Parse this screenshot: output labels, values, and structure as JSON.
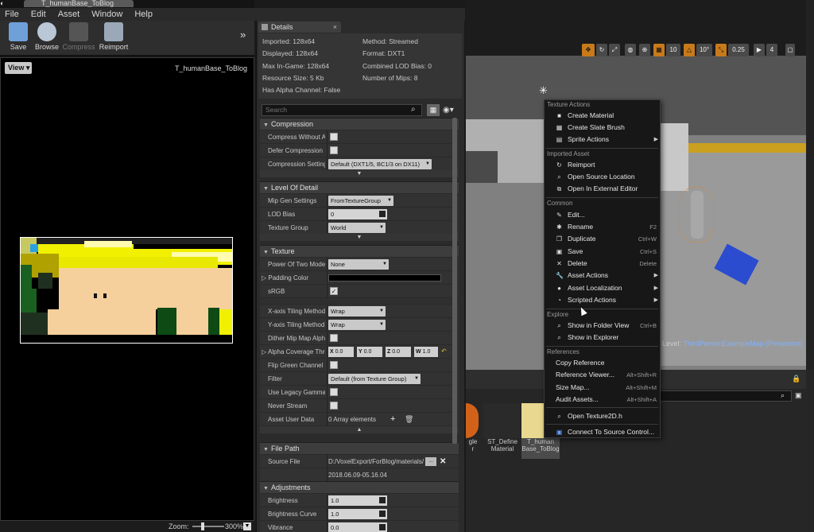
{
  "window": {
    "tab_title": "T_humanBase_ToBlog",
    "menu": [
      "File",
      "Edit",
      "Asset",
      "Window",
      "Help"
    ]
  },
  "toolbar": {
    "save": "Save",
    "browse": "Browse",
    "compress": "Compress",
    "reimport": "Reimport"
  },
  "viewport": {
    "view_button": "View",
    "asset_name": "T_humanBase_ToBlog",
    "zoom_label": "Zoom:",
    "zoom_value": "300%",
    "zoom_level": 0.3
  },
  "details": {
    "tab": "Details",
    "info_left": [
      "Imported: 128x64",
      "Displayed: 128x64",
      "Max In-Game: 128x64",
      "Resource Size: 5 Kb",
      "Has Alpha Channel: False"
    ],
    "info_right": [
      "Method: Streamed",
      "Format: DXT1",
      "Combined LOD Bias: 0",
      "Number of Mips: 8"
    ],
    "search_placeholder": "Search",
    "compression": {
      "header": "Compression",
      "compress_without_alpha": "Compress Without Al",
      "defer_compression": "Defer Compression",
      "compression_settings": "Compression Setting",
      "compression_settings_value": "Default (DXT1/5, BC1/3 on DX11)"
    },
    "lod": {
      "header": "Level Of Detail",
      "mip_gen": "Mip Gen Settings",
      "mip_gen_value": "FromTextureGroup",
      "lod_bias": "LOD Bias",
      "lod_bias_value": "0",
      "texture_group": "Texture Group",
      "texture_group_value": "World"
    },
    "texture": {
      "header": "Texture",
      "power_of_two": "Power Of Two Mode",
      "power_of_two_value": "None",
      "padding_color": "Padding Color",
      "srgb": "sRGB",
      "x_tiling": "X-axis Tiling Method",
      "x_tiling_value": "Wrap",
      "y_tiling": "Y-axis Tiling Method",
      "y_tiling_value": "Wrap",
      "dither": "Dither Mip Map Alpha",
      "alpha_coverage": "Alpha Coverage Thre",
      "vec_x_label": "X",
      "vec_x": "0.0",
      "vec_y_label": "Y",
      "vec_y": "0.0",
      "vec_z_label": "Z",
      "vec_z": "0.0",
      "vec_w_label": "W",
      "vec_w": "1.0",
      "flip_green": "Flip Green Channel",
      "filter": "Filter",
      "filter_value": "Default (from Texture Group)",
      "legacy_gamma": "Use Legacy Gamma",
      "never_stream": "Never Stream",
      "asset_user_data": "Asset User Data",
      "asset_user_data_value": "0 Array elements"
    },
    "file_path": {
      "header": "File Path",
      "source_file": "Source File",
      "source_path": "D:/VoxelExport/ForBlog/materials/",
      "browse_dots": "...",
      "source_date": "2018.06.09-05.16.04"
    },
    "adjustments": {
      "header": "Adjustments",
      "brightness": "Brightness",
      "brightness_value": "1.0",
      "brightness_curve": "Brightness Curve",
      "brightness_curve_value": "1.0",
      "vibrance": "Vibrance",
      "vibrance_value": "0.0"
    }
  },
  "level": {
    "toolbar": [
      "10",
      "10°",
      "0.25",
      "4"
    ],
    "label_prefix": "Level:",
    "label_map": "ThirdPersonExampleMap (Persistent)"
  },
  "content_browser": {
    "assets": [
      {
        "label": "gle\nr"
      },
      {
        "label": "ST_Define\nMaterial"
      },
      {
        "label": "T_human\nBase_ToBlog"
      }
    ]
  },
  "context_menu": {
    "sections": {
      "texture_actions": "Texture Actions",
      "imported_asset": "Imported Asset",
      "common": "Common",
      "explore": "Explore",
      "references": "References"
    },
    "items": {
      "create_material": "Create Material",
      "create_slate_brush": "Create Slate Brush",
      "sprite_actions": "Sprite Actions",
      "reimport": "Reimport",
      "open_source_location": "Open Source Location",
      "open_external_editor": "Open In External Editor",
      "edit": "Edit...",
      "rename": "Rename",
      "rename_key": "F2",
      "duplicate": "Duplicate",
      "duplicate_key": "Ctrl+W",
      "save": "Save",
      "save_key": "Ctrl+S",
      "delete": "Delete",
      "delete_key": "Delete",
      "asset_actions": "Asset Actions",
      "asset_localization": "Asset Localization",
      "scripted_actions": "Scripted Actions",
      "show_in_folder_view": "Show in Folder View",
      "show_in_folder_view_key": "Ctrl+B",
      "show_in_explorer": "Show in Explorer",
      "copy_reference": "Copy Reference",
      "reference_viewer": "Reference Viewer...",
      "reference_viewer_key": "Alt+Shift+R",
      "size_map": "Size Map...",
      "size_map_key": "Alt+Shift+M",
      "audit_assets": "Audit Assets...",
      "audit_assets_key": "Alt+Shift+A",
      "open_texture2d": "Open Texture2D.h",
      "connect_source_control": "Connect To Source Control..."
    }
  }
}
